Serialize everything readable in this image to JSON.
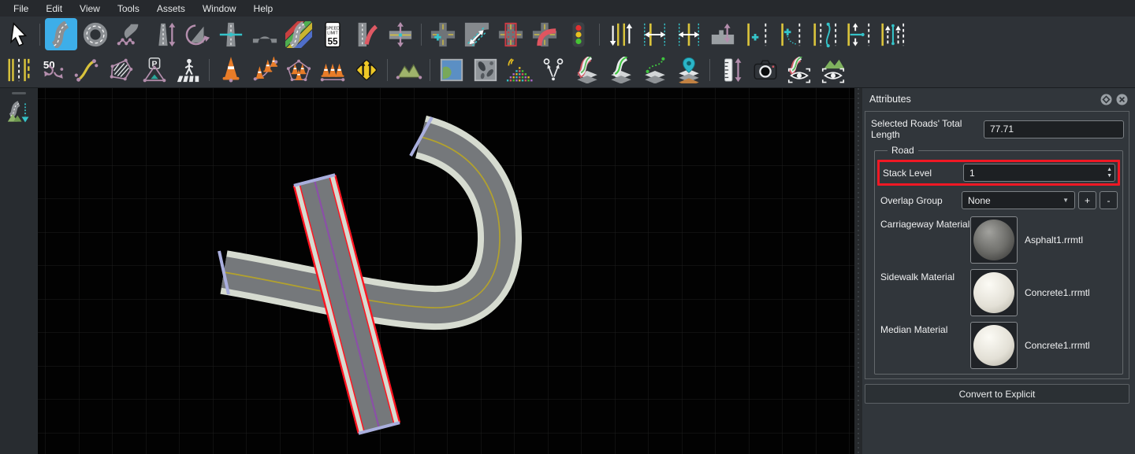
{
  "menu": {
    "items": [
      "File",
      "Edit",
      "View",
      "Tools",
      "Assets",
      "Window",
      "Help"
    ]
  },
  "toolbar_row1": {
    "items": [
      {
        "name": "select-tool",
        "icon": "select",
        "selected": false
      },
      {
        "type": "separator"
      },
      {
        "name": "road-plan-tool",
        "icon": "road-plan",
        "selected": true
      },
      {
        "name": "roundabout-tool",
        "icon": "roundabout",
        "selected": false
      },
      {
        "name": "road-control-points-tool",
        "icon": "road-points",
        "selected": false
      },
      {
        "name": "road-height-tool",
        "icon": "road-height",
        "selected": false
      },
      {
        "name": "road-superelevation-tool",
        "icon": "superelevation",
        "selected": false
      },
      {
        "name": "cross-section-tool",
        "icon": "cross-section",
        "selected": false
      },
      {
        "name": "bridge-span-tool",
        "icon": "bridge",
        "selected": false
      },
      {
        "name": "road-surface-tool",
        "icon": "surface",
        "selected": false
      },
      {
        "name": "speed-limit-tool",
        "icon": "speed-limit",
        "selected": false,
        "sign_lines": [
          "SPEED",
          "LIMIT",
          "55"
        ]
      },
      {
        "name": "lane-ramp-tool",
        "icon": "lane-ramp",
        "selected": false
      },
      {
        "name": "road-offset-tool",
        "icon": "road-shift",
        "selected": false
      },
      {
        "type": "separator"
      },
      {
        "name": "intersection-tool",
        "icon": "int-plus",
        "selected": false
      },
      {
        "name": "junction-lanes-tool",
        "icon": "junction-arrows",
        "selected": false
      },
      {
        "name": "intersection-bounds-tool",
        "icon": "int-box",
        "selected": false
      },
      {
        "name": "intersection-turn-tool",
        "icon": "int-turn",
        "selected": false
      },
      {
        "name": "traffic-signal-tool",
        "icon": "traffic-light",
        "selected": false
      },
      {
        "type": "separator"
      },
      {
        "name": "lane-direction-tool",
        "icon": "lane-direction",
        "selected": false
      },
      {
        "name": "lane-width-tool",
        "icon": "lane-width",
        "selected": false
      },
      {
        "name": "lane-offset-tool",
        "icon": "lane-offset",
        "selected": false
      },
      {
        "name": "curb-profile-tool",
        "icon": "curb",
        "selected": false
      },
      {
        "name": "lane-add-tool",
        "icon": "lane-add",
        "selected": false
      },
      {
        "name": "lane-taper-tool",
        "icon": "lane-taper",
        "selected": false
      },
      {
        "name": "lane-shape-tool",
        "icon": "lane-shape",
        "selected": false
      },
      {
        "name": "lane-connect-tool",
        "icon": "lane-connect",
        "selected": false
      },
      {
        "name": "lane-height-tool",
        "icon": "lane-height",
        "selected": false
      }
    ]
  },
  "toolbar_row2": {
    "items": [
      {
        "name": "marking-lane-tool",
        "icon": "marking-lanes",
        "selected": false
      },
      {
        "name": "marking-maneuver-tool",
        "icon": "marking-50",
        "selected": false,
        "text": "50"
      },
      {
        "name": "marking-curve-tool",
        "icon": "marking-curve",
        "selected": false
      },
      {
        "name": "marking-polygon-tool",
        "icon": "marking-polygon",
        "selected": false
      },
      {
        "name": "parking-tool",
        "icon": "parking",
        "selected": false,
        "text": "P"
      },
      {
        "name": "crosswalk-tool",
        "icon": "crosswalk",
        "selected": false
      },
      {
        "type": "separator"
      },
      {
        "name": "prop-point-tool",
        "icon": "prop-cone",
        "selected": false
      },
      {
        "name": "prop-curve-tool",
        "icon": "prop-curve",
        "selected": false
      },
      {
        "name": "prop-polygon-tool",
        "icon": "prop-polygon",
        "selected": false
      },
      {
        "name": "prop-span-tool",
        "icon": "prop-span",
        "selected": false
      },
      {
        "name": "signal-sign-tool",
        "icon": "signal-sign",
        "selected": false
      },
      {
        "type": "separator"
      },
      {
        "name": "terrain-tool",
        "icon": "terrain",
        "selected": false
      },
      {
        "type": "separator"
      },
      {
        "name": "aerial-image-tool",
        "icon": "aerial",
        "selected": false
      },
      {
        "name": "elevation-map-tool",
        "icon": "heightmap",
        "selected": false
      },
      {
        "name": "point-cloud-tool",
        "icon": "pointcloud",
        "selected": false
      },
      {
        "name": "scenario-tool",
        "icon": "scenario",
        "selected": false
      },
      {
        "name": "road-semantics-tool",
        "icon": "road-semantic",
        "selected": false
      },
      {
        "name": "road-reference-tool",
        "icon": "road-green",
        "selected": false
      },
      {
        "name": "reference-curve-tool",
        "icon": "curve-layers",
        "selected": false
      },
      {
        "name": "asset-pin-tool",
        "icon": "pin-layers",
        "selected": false
      },
      {
        "type": "separator"
      },
      {
        "name": "measure-tool",
        "icon": "measure",
        "selected": false
      },
      {
        "name": "camera-tool",
        "icon": "camera",
        "selected": false
      },
      {
        "name": "road-visibility-toggle",
        "icon": "road-vis",
        "selected": false
      },
      {
        "name": "terrain-visibility-toggle",
        "icon": "terrain-vis",
        "selected": false
      }
    ]
  },
  "sidebar": {
    "items": [
      {
        "name": "scene-export-tool",
        "icon": "scene-export",
        "selected": false
      }
    ]
  },
  "canvas": {
    "selected_road_outline_color": "#ff1420",
    "selected_road_centerline_color": "#8b4fa8",
    "road_centerline_color": "#b3a22c",
    "road_endcap_color": "#a9aedd",
    "sidewalk_color": "#d6dbd0",
    "carriageway_color": "#75787b"
  },
  "attributes_panel": {
    "title": "Attributes",
    "total_length": {
      "label": "Selected Roads' Total Length",
      "value": "77.71"
    },
    "road_group": {
      "title": "Road",
      "stack_level": {
        "label": "Stack Level",
        "value": "1",
        "highlighted": true,
        "highlight_color": "#f01824"
      },
      "overlap_group": {
        "label": "Overlap Group",
        "value": "None",
        "add_label": "+",
        "remove_label": "-"
      },
      "materials": [
        {
          "label": "Carriageway Material",
          "file": "Asphalt1.rrmtl",
          "thumb": "asphalt"
        },
        {
          "label": "Sidewalk Material",
          "file": "Concrete1.rrmtl",
          "thumb": "concrete"
        },
        {
          "label": "Median Material",
          "file": "Concrete1.rrmtl",
          "thumb": "concrete"
        }
      ]
    },
    "convert_button_label": "Convert to Explicit"
  },
  "colors": {
    "toolbar_selected_bg": "#3daee9",
    "panel_bg": "#31363b",
    "canvas_bg": "#020202"
  }
}
